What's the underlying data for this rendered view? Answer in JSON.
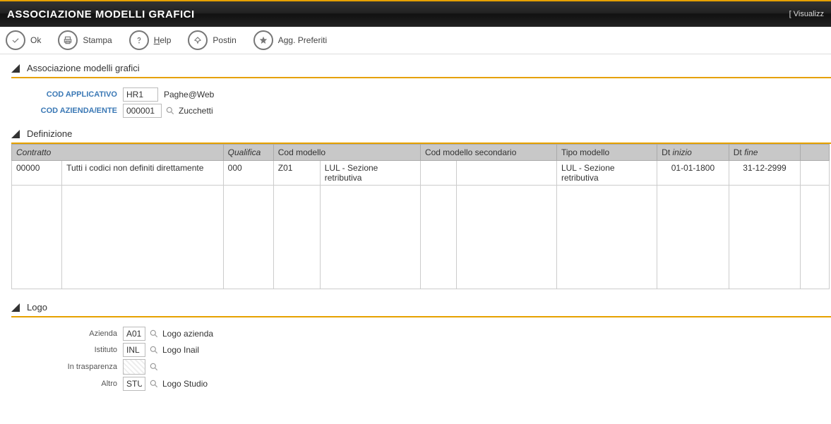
{
  "titlebar": {
    "title": "ASSOCIAZIONE MODELLI GRAFICI",
    "right": "[ Visualizz"
  },
  "toolbar": {
    "ok": "Ok",
    "stampa": "Stampa",
    "help_h": "H",
    "help_rest": "elp",
    "postin": "Postin",
    "favoriti": "Agg. Preferiti"
  },
  "sections": {
    "assoc": "Associazione modelli grafici",
    "defin": "Definizione",
    "logo": "Logo"
  },
  "form": {
    "cod_applicativo_label": "COD APPLICATIVO",
    "cod_applicativo_value": "HR1",
    "cod_applicativo_desc": "Paghe@Web",
    "cod_azienda_label": "COD AZIENDA/ENTE",
    "cod_azienda_value": "000001",
    "cod_azienda_desc": "Zucchetti"
  },
  "table": {
    "headers": {
      "contratto": "Contratto",
      "contratto_desc": "",
      "qualifica": "Qualifica",
      "cod_modello": "Cod modello",
      "cod_modello_desc": "",
      "cod_modello_sec": "Cod modello secondario",
      "cod_modello_sec_desc": "",
      "tipo_modello": "Tipo modello",
      "dt_label": "Dt ",
      "dt_inizio": "inizio",
      "dt_fine": "fine"
    },
    "row": {
      "contratto": "00000",
      "contratto_desc": "Tutti i codici non definiti direttamente",
      "qualifica": "000",
      "cod_modello": "Z01",
      "cod_modello_desc": "LUL - Sezione retributiva",
      "cod_modello_sec": "",
      "cod_modello_sec_desc": "",
      "tipo_modello": "LUL - Sezione retributiva",
      "dt_inizio": "01-01-1800",
      "dt_fine": "31-12-2999"
    }
  },
  "logo": {
    "azienda_label": "Azienda",
    "azienda_value": "A01",
    "azienda_desc": "Logo azienda",
    "istituto_label": "Istituto",
    "istituto_value": "INL",
    "istituto_desc": "Logo Inail",
    "trasp_label": "In trasparenza",
    "altro_label": "Altro",
    "altro_value": "STU",
    "altro_desc": "Logo Studio"
  }
}
